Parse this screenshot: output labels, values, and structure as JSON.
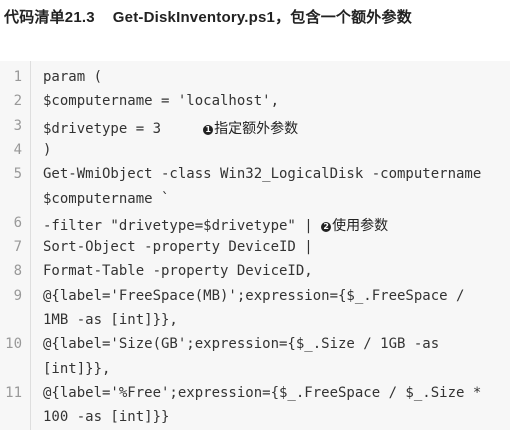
{
  "caption": {
    "label": "代码清单21.3",
    "title": "Get-DiskInventory.ps1，包含一个额外参数"
  },
  "code": {
    "lines": [
      {
        "num": "1",
        "rows": [
          "param ("
        ]
      },
      {
        "num": "2",
        "rows": [
          "$computername = 'localhost',"
        ]
      },
      {
        "num": "3",
        "rows": [
          "$drivetype = 3     "
        ],
        "marker": "1",
        "annotation": "指定额外参数"
      },
      {
        "num": "4",
        "rows": [
          ")"
        ]
      },
      {
        "num": "5",
        "rows": [
          "Get-WmiObject -class Win32_LogicalDisk -computername",
          "$computername `"
        ]
      },
      {
        "num": "6",
        "rows": [
          "-filter \"drivetype=$drivetype\" | "
        ],
        "marker": "2",
        "annotation": "使用参数"
      },
      {
        "num": "7",
        "rows": [
          "Sort-Object -property DeviceID |"
        ]
      },
      {
        "num": "8",
        "rows": [
          "Format-Table -property DeviceID,"
        ]
      },
      {
        "num": "9",
        "rows": [
          "@{label='FreeSpace(MB)';expression={$_.FreeSpace /",
          "1MB -as [int]}},"
        ]
      },
      {
        "num": "10",
        "rows": [
          "@{label='Size(GB';expression={$_.Size / 1GB -as",
          "[int]}},"
        ]
      },
      {
        "num": "11",
        "rows": [
          "@{label='%Free';expression={$_.FreeSpace / $_.Size *",
          "100 -as [int]}}"
        ]
      }
    ]
  }
}
